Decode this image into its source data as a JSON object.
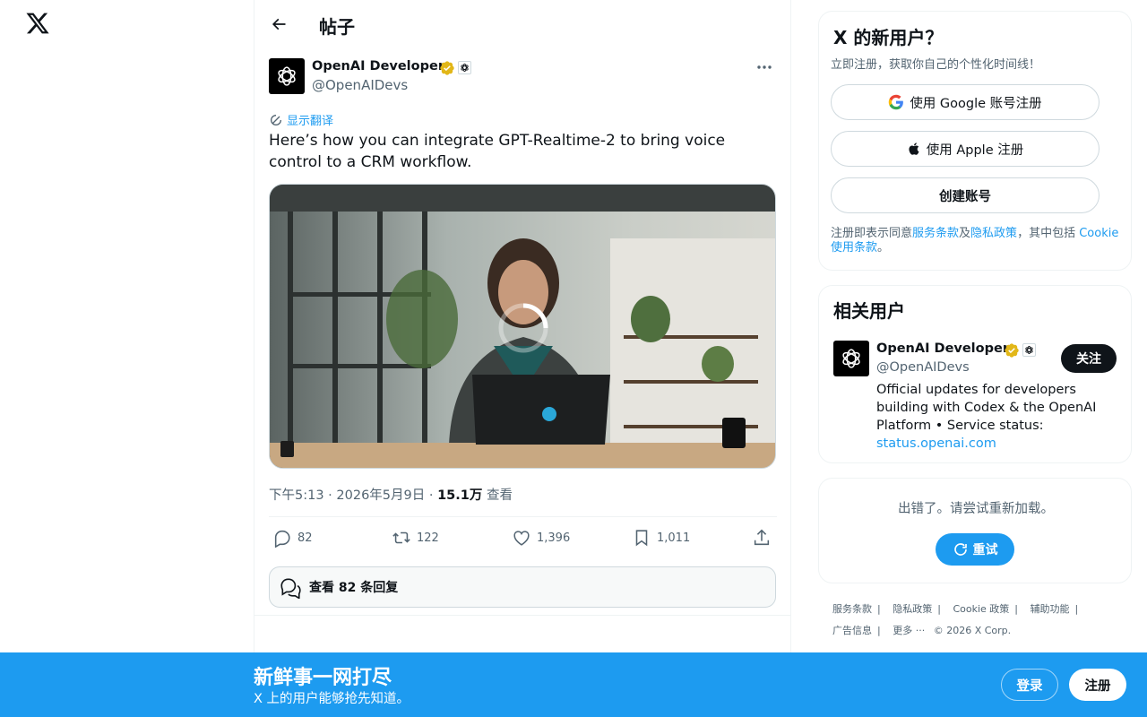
{
  "header": {
    "title": "帖子"
  },
  "post": {
    "author_name": "OpenAI Developers",
    "author_handle": "@OpenAIDevs",
    "translate_label": "显示翻译",
    "text": "Here’s how you can integrate GPT-Realtime-2 to bring voice control to a CRM workflow.",
    "time": "下午5:13 · 2026年5月9日 · ",
    "views_count": "15.1万",
    "views_label": " 查看",
    "replies": "82",
    "reposts": "122",
    "likes": "1,396",
    "bookmarks": "1,011",
    "view_replies_label": "查看 82 条回复"
  },
  "signup": {
    "title": "X 的新用户？",
    "subtitle": "立即注册，获取你自己的个性化时间线！",
    "google_label": "使用 Google 账号注册",
    "apple_label": "使用 Apple 注册",
    "create_label": "创建账号",
    "terms_prefix": "注册即表示同意",
    "terms_link": "服务条款",
    "terms_and": "及",
    "privacy_link": "隐私政策",
    "terms_mid": "，其中包括 ",
    "cookie_link": "Cookie 使用条款",
    "terms_end": "。"
  },
  "related": {
    "title": "相关用户",
    "name": "OpenAI Developers",
    "handle": "@OpenAIDevs",
    "follow_label": "关注",
    "bio": "Official updates for developers building with Codex & the OpenAI Platform • Service status: ",
    "bio_link": "status.openai.com"
  },
  "error": {
    "message": "出错了。请尝试重新加载。",
    "retry_label": "重试"
  },
  "footer": {
    "links": [
      "服务条款",
      "隐私政策",
      "Cookie 政策",
      "辅助功能",
      "广告信息",
      "更多 ···"
    ],
    "copyright": "© 2026 X Corp."
  },
  "bottom_bar": {
    "title": "新鲜事一网打尽",
    "subtitle": "X 上的用户能够抢先知道。",
    "login_label": "登录",
    "signup_label": "注册"
  },
  "colors": {
    "accent": "#1d9bf0",
    "text": "#0f1419",
    "muted": "#536471",
    "verified": "#e2b719"
  }
}
